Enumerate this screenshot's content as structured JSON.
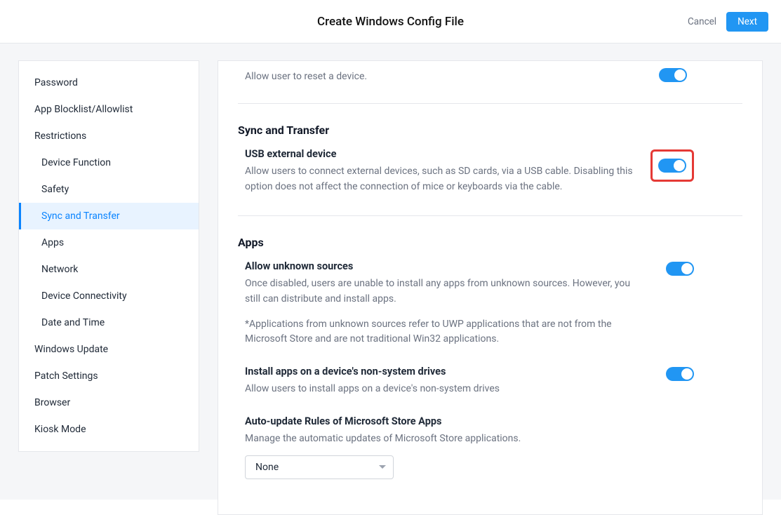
{
  "header": {
    "title": "Create Windows Config File",
    "cancel": "Cancel",
    "next": "Next"
  },
  "sidebar": {
    "items": [
      {
        "label": "Password",
        "kind": "top"
      },
      {
        "label": "App Blocklist/Allowlist",
        "kind": "top"
      },
      {
        "label": "Restrictions",
        "kind": "top"
      },
      {
        "label": "Device Function",
        "kind": "sub"
      },
      {
        "label": "Safety",
        "kind": "sub"
      },
      {
        "label": "Sync and Transfer",
        "kind": "sub",
        "active": true
      },
      {
        "label": "Apps",
        "kind": "sub"
      },
      {
        "label": "Network",
        "kind": "sub"
      },
      {
        "label": "Device Connectivity",
        "kind": "sub"
      },
      {
        "label": "Date and Time",
        "kind": "sub"
      },
      {
        "label": "Windows Update",
        "kind": "top"
      },
      {
        "label": "Patch Settings",
        "kind": "top"
      },
      {
        "label": "Browser",
        "kind": "top"
      },
      {
        "label": "Kiosk Mode",
        "kind": "top"
      }
    ]
  },
  "top_desc": "Allow user to reset a device.",
  "sync": {
    "heading": "Sync and Transfer",
    "usb": {
      "title": "USB external device",
      "desc": "Allow users to connect external devices, such as SD cards, via a USB cable. Disabling this option does not affect the connection of mice or keyboards via the cable."
    }
  },
  "apps": {
    "heading": "Apps",
    "unknown": {
      "title": "Allow unknown sources",
      "desc": "Once disabled, users are unable to install any apps from unknown sources. However, you still can distribute and install apps.",
      "note": "*Applications from unknown sources refer to UWP applications that are not from the Microsoft Store and are not traditional Win32 applications."
    },
    "nonsys": {
      "title": "Install apps on a device's non-system drives",
      "desc": "Allow users to install apps on a device's non-system drives"
    },
    "auto": {
      "title": "Auto-update Rules of Microsoft Store Apps",
      "desc": "Manage the automatic updates of Microsoft Store applications.",
      "select": "None"
    }
  }
}
